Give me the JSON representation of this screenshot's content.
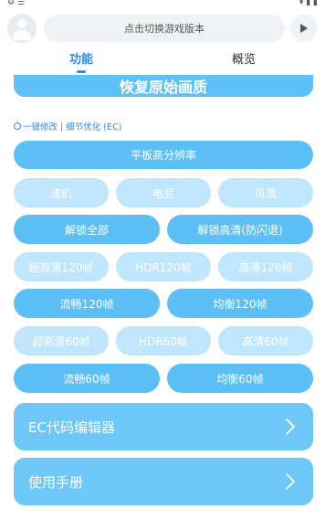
{
  "header": {
    "version_placeholder": "点击切换游戏版本"
  },
  "tabs": [
    {
      "label": "功能",
      "active": true
    },
    {
      "label": "概览",
      "active": false
    }
  ],
  "restore_button": "恢复原始画质",
  "section_label": "一键修改 | 细节优化 (EC)",
  "buttons": {
    "tablet_hd": "平板高分辨率",
    "row2": [
      "渣机",
      "电竞",
      "风景"
    ],
    "unlock_all": "解锁全部",
    "unlock_hd": "解锁高清(防闪退)",
    "row4": [
      "超高清120帧",
      "HDR120帧",
      "高清120帧"
    ],
    "smooth_120": "流畅120帧",
    "balance_120": "均衡120帧",
    "row6": [
      "超高清60帧",
      "HDR60帧",
      "高清60帧"
    ],
    "smooth_60": "流畅60帧",
    "balance_60": "均衡60帧"
  },
  "panels": {
    "ec_editor": "EC代码编辑器",
    "manual": "使用手册"
  },
  "colors": {
    "accent": "#2f8cf0",
    "button_dark": "#5cc0f6",
    "button_light": "#bfe6fc",
    "panel": "#6ec8f7"
  },
  "icons": [
    "avatar-icon",
    "play-icon",
    "ring-icon",
    "chevron-right-icon"
  ]
}
